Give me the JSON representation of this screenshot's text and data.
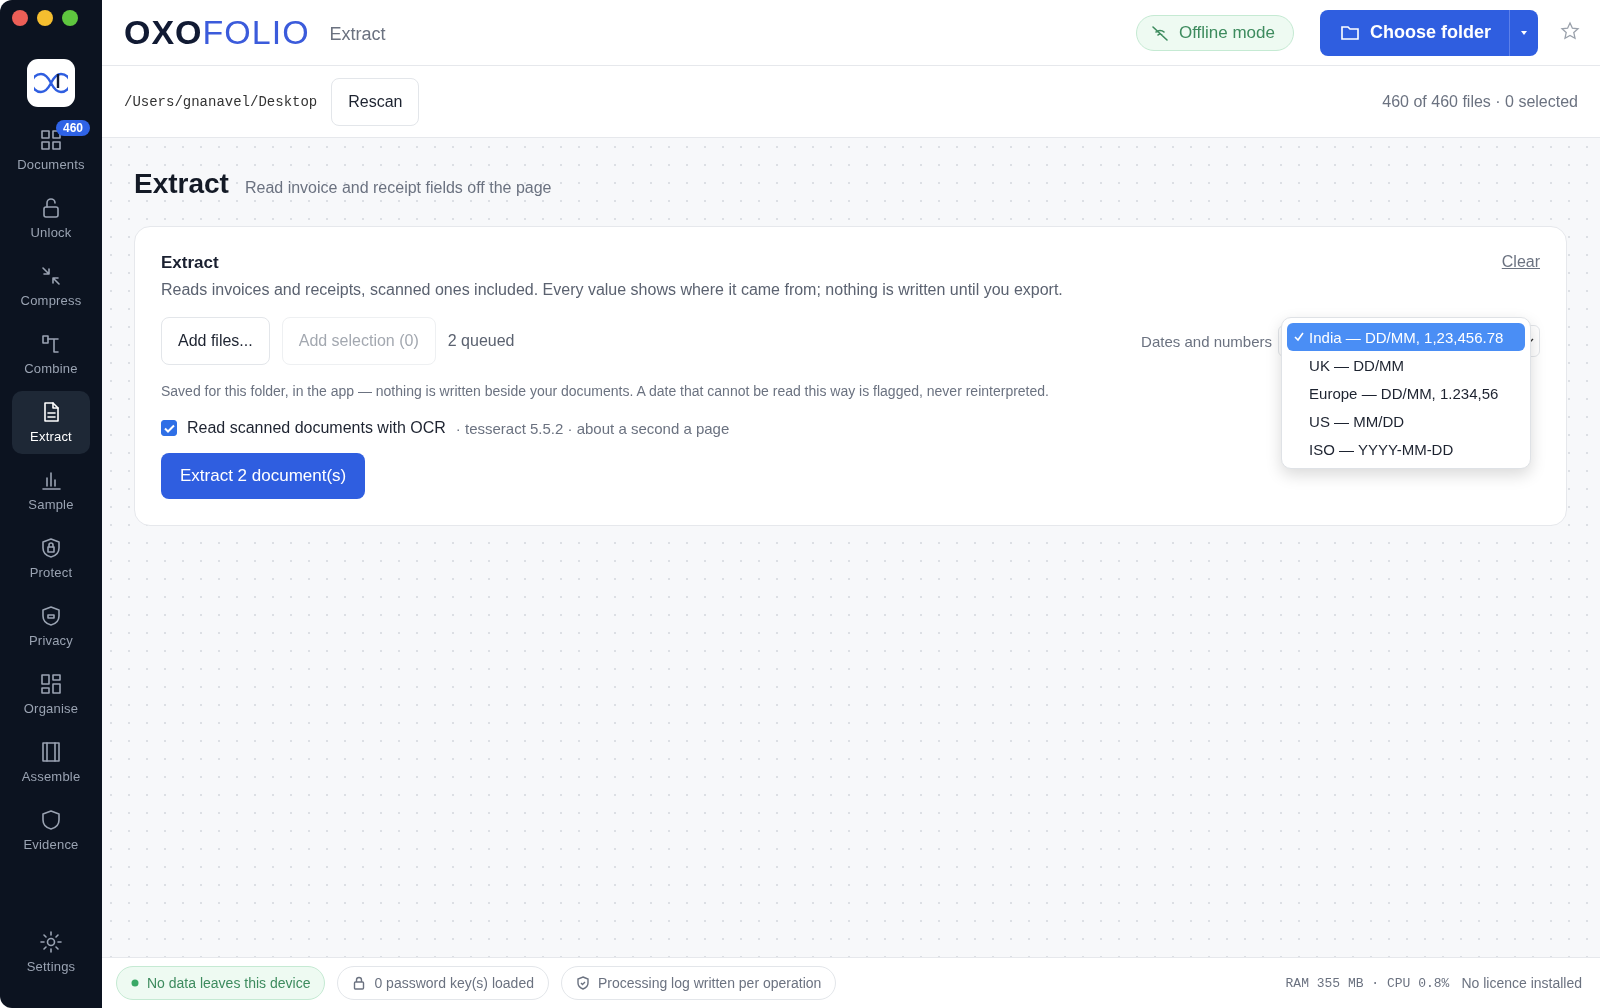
{
  "app": {
    "logo_dark": "OXO",
    "logo_light": "FOLIO",
    "section": "Extract"
  },
  "sidebar": {
    "items": [
      {
        "kind": "documents",
        "label": "Documents",
        "badge": "460",
        "selected": false
      },
      {
        "kind": "unlock",
        "label": "Unlock",
        "selected": false
      },
      {
        "kind": "compress",
        "label": "Compress",
        "selected": false
      },
      {
        "kind": "combine",
        "label": "Combine",
        "selected": false
      },
      {
        "kind": "extract",
        "label": "Extract",
        "selected": true
      },
      {
        "kind": "sample",
        "label": "Sample",
        "selected": false
      },
      {
        "kind": "protect",
        "label": "Protect",
        "selected": false
      },
      {
        "kind": "privacy",
        "label": "Privacy",
        "selected": false
      },
      {
        "kind": "organise",
        "label": "Organise",
        "selected": false
      },
      {
        "kind": "assemble",
        "label": "Assemble",
        "selected": false
      },
      {
        "kind": "evidence",
        "label": "Evidence",
        "selected": false
      }
    ],
    "settings": {
      "label": "Settings"
    }
  },
  "header": {
    "offline": "Offline mode",
    "primary": "Choose folder",
    "starred": false
  },
  "pathbar": {
    "path": "/Users/gnanavel/Desktop",
    "rescan": "Rescan",
    "summary": "460 of 460 files · 0 selected"
  },
  "page": {
    "title": "Extract",
    "subtitle": "Read invoice and receipt fields off the page"
  },
  "card": {
    "title": "Extract",
    "description": "Reads invoices and receipts, scanned ones included. Every value shows where it came from; nothing is written until you export.",
    "clear": "Clear",
    "buttons": [
      {
        "label": "Add files...",
        "disabled": false
      },
      {
        "label": "Add selection (0)",
        "disabled": true
      }
    ],
    "queued": "2 queued",
    "locale_label": "Dates and numbers",
    "note": "Saved for this folder, in the app — nothing is written beside your documents. A date that cannot be read this way is flagged, never reinterpreted.",
    "ocr": {
      "checked": true,
      "label": "Read scanned documents with OCR",
      "detail": "· tesseract 5.5.2 · about a second a page"
    },
    "run": "Extract 2 document(s)"
  },
  "locale_menu": {
    "options": [
      {
        "label": "India — DD/MM, 1,23,456.78",
        "selected": true
      },
      {
        "label": "UK — DD/MM",
        "selected": false
      },
      {
        "label": "Europe — DD/MM, 1.234,56",
        "selected": false
      },
      {
        "label": "US — MM/DD",
        "selected": false
      },
      {
        "label": "ISO — YYYY-MM-DD",
        "selected": false
      }
    ]
  },
  "footer": {
    "badges": [
      {
        "kind": "dot",
        "label": "No data leaves this device"
      },
      {
        "kind": "lock",
        "label": "0 password key(s) loaded"
      },
      {
        "kind": "shield",
        "label": "Processing log written per operation"
      }
    ],
    "stats": "RAM 355 MB · CPU 0.8%",
    "licence": "No licence installed"
  }
}
